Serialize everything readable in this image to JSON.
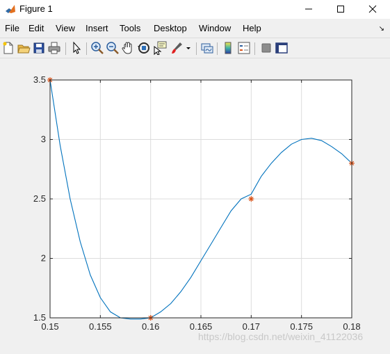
{
  "window": {
    "title": "Figure 1",
    "app_icon": "matlab-icon",
    "controls": [
      "minimize-icon",
      "maximize-icon",
      "close-icon"
    ]
  },
  "menu": {
    "items": [
      "File",
      "Edit",
      "View",
      "Insert",
      "Tools",
      "Desktop",
      "Window",
      "Help"
    ],
    "overflow_icon": "chevron-down-icon"
  },
  "toolbar": {
    "buttons": [
      "new-figure-icon",
      "open-file-icon",
      "save-icon",
      "print-icon",
      "pointer-icon",
      "zoom-in-icon",
      "zoom-out-icon",
      "pan-icon",
      "rotate-3d-icon",
      "data-cursor-icon",
      "brush-icon",
      "link-plot-icon",
      "colorbar-icon",
      "legend-icon",
      "hide-plot-tools-icon",
      "show-plot-tools-icon"
    ]
  },
  "watermark": "https://blog.csdn.net/weixin_41122036",
  "chart_data": {
    "type": "line",
    "title": "",
    "xlabel": "",
    "ylabel": "",
    "xlim": [
      0.15,
      0.18
    ],
    "ylim": [
      1.5,
      3.5
    ],
    "xticks": [
      "0.15",
      "0.155",
      "0.16",
      "0.165",
      "0.17",
      "0.175",
      "0.18"
    ],
    "yticks": [
      "1.5",
      "2",
      "2.5",
      "3",
      "3.5"
    ],
    "grid": true,
    "series": [
      {
        "color": "#0072bd",
        "x": [
          0.15,
          0.151,
          0.152,
          0.153,
          0.154,
          0.155,
          0.156,
          0.157,
          0.158,
          0.159,
          0.16,
          0.161,
          0.162,
          0.163,
          0.164,
          0.165,
          0.166,
          0.167,
          0.168,
          0.169,
          0.17,
          0.171,
          0.172,
          0.173,
          0.174,
          0.175,
          0.176,
          0.177,
          0.178,
          0.179,
          0.18
        ],
        "y": [
          3.5,
          2.95,
          2.5,
          2.14,
          1.86,
          1.67,
          1.55,
          1.5,
          1.49,
          1.49,
          1.5,
          1.55,
          1.62,
          1.72,
          1.84,
          1.98,
          2.12,
          2.26,
          2.4,
          2.5,
          2.54,
          2.69,
          2.8,
          2.89,
          2.96,
          3.0,
          3.01,
          2.99,
          2.94,
          2.88,
          2.8
        ]
      },
      {
        "type": "scatter",
        "marker": "asterisk",
        "color": "#d95319",
        "x": [
          0.15,
          0.16,
          0.17,
          0.18
        ],
        "y": [
          3.5,
          1.5,
          2.5,
          2.8
        ]
      }
    ]
  }
}
